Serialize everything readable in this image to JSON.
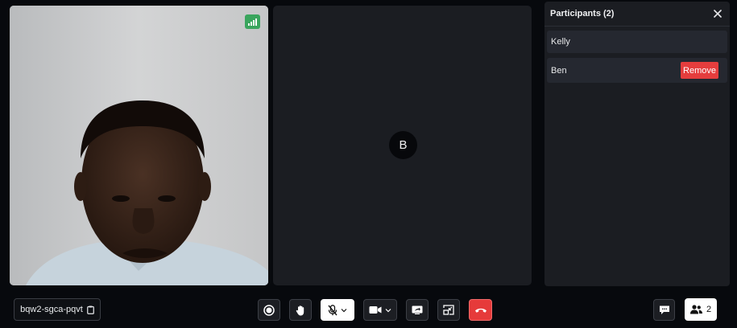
{
  "tiles": {
    "local": {
      "name": "local-video-tile",
      "signal_icon": "signal-bars-icon",
      "signal_color": "#3aa55d"
    },
    "remote": {
      "initial": "B"
    }
  },
  "participants": {
    "title": "Participants (2)",
    "close_icon": "close-icon",
    "list": [
      {
        "name": "Kelly"
      },
      {
        "name": "Ben",
        "action": "Remove"
      }
    ]
  },
  "bottom_bar": {
    "meeting_code": "bqw2-sgca-pqvt",
    "copy_icon": "clipboard-icon",
    "controls": [
      {
        "id": "record",
        "icon": "record-icon"
      },
      {
        "id": "raise-hand",
        "icon": "hand-icon"
      },
      {
        "id": "mic",
        "icon": "mic-off-icon",
        "state": "muted"
      },
      {
        "id": "camera",
        "icon": "video-camera-icon"
      },
      {
        "id": "screen-share",
        "icon": "screen-share-icon"
      },
      {
        "id": "picture-in-picture",
        "icon": "pip-icon"
      },
      {
        "id": "leave",
        "icon": "phone-hangup-icon"
      }
    ],
    "chat_icon": "chat-icon",
    "people_icon": "people-icon",
    "participant_count": "2"
  },
  "colors": {
    "background": "#07090d",
    "tile": "#1b1d22",
    "danger": "#e53d3d",
    "signal": "#3aa55d"
  }
}
